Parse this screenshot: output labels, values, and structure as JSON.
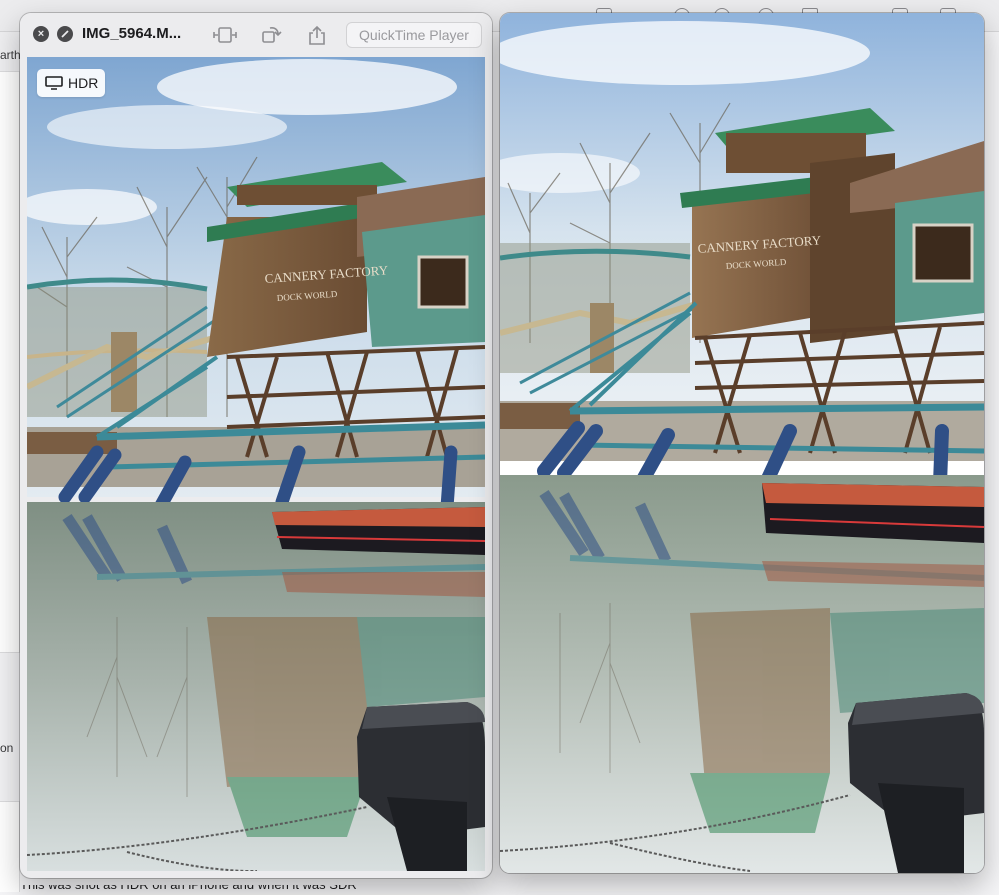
{
  "background_app": {
    "left_fragments": [
      "arth",
      "on"
    ],
    "footer_text": "This was shot as HDR on an iPhone and when it was SDR"
  },
  "quicktime_window": {
    "title": "IMG_5964.M...",
    "app_label": "QuickTime Player",
    "hdr_badge": "HDR"
  },
  "photo_scene": {
    "sign_line_1": "CANNERY FACTORY",
    "sign_line_2": "DOCK WORLD"
  },
  "icons": {
    "close": "close-icon",
    "fullscreen": "fullscreen-icon",
    "trim": "filmstrip-icon",
    "rotate": "rotate-icon",
    "share": "share-icon",
    "display": "display-icon"
  },
  "colors": {
    "sky": "#cfe0ee",
    "roof_green": "#3c8a5c",
    "wood": "#7a5a3c",
    "steel_blue": "#2f4f86",
    "water": "#9aa9a0"
  }
}
